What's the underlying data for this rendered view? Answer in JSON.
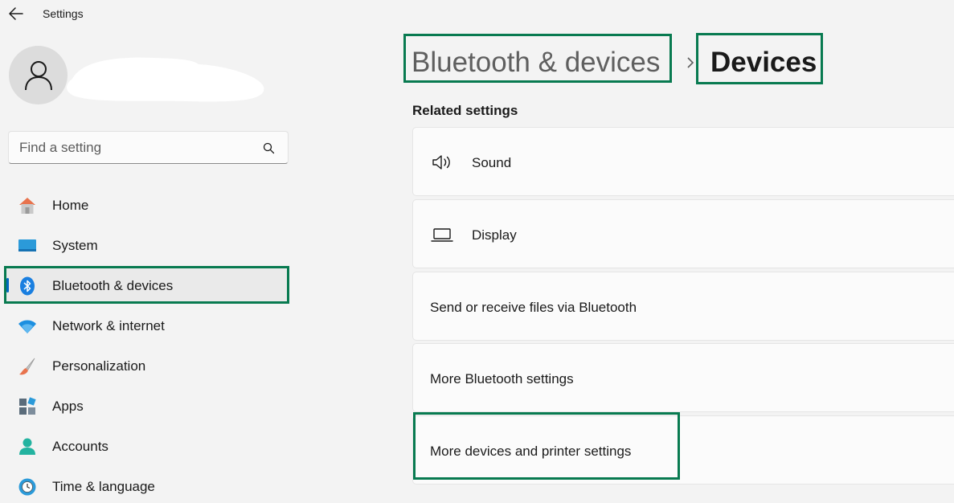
{
  "window": {
    "title": "Settings",
    "back_icon": "back-arrow-icon"
  },
  "search": {
    "placeholder": "Find a setting",
    "value": "",
    "icon": "search-icon"
  },
  "sidebar": {
    "items": [
      {
        "label": "Home",
        "icon": "home-icon"
      },
      {
        "label": "System",
        "icon": "system-icon"
      },
      {
        "label": "Bluetooth & devices",
        "icon": "bluetooth-icon",
        "active": true
      },
      {
        "label": "Network & internet",
        "icon": "wifi-icon"
      },
      {
        "label": "Personalization",
        "icon": "brush-icon"
      },
      {
        "label": "Apps",
        "icon": "apps-icon"
      },
      {
        "label": "Accounts",
        "icon": "accounts-icon"
      },
      {
        "label": "Time & language",
        "icon": "clock-globe-icon"
      }
    ]
  },
  "breadcrumb": {
    "parent": "Bluetooth & devices",
    "current": "Devices"
  },
  "main": {
    "section_title": "Related settings",
    "cards": [
      {
        "label": "Sound",
        "icon": "speaker-icon"
      },
      {
        "label": "Display",
        "icon": "laptop-icon"
      },
      {
        "label": "Send or receive files via Bluetooth"
      },
      {
        "label": "More Bluetooth settings"
      },
      {
        "label": "More devices and printer settings"
      }
    ]
  },
  "colors": {
    "accent": "#0067c0",
    "highlight_border": "#087a50",
    "background": "#f3f3f3",
    "card": "#fbfbfb"
  }
}
